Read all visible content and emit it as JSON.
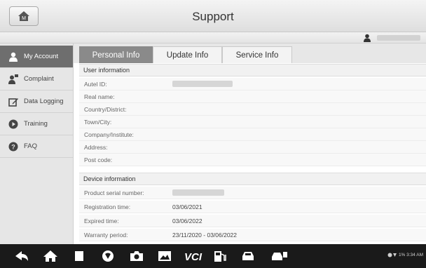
{
  "header": {
    "title": "Support",
    "home_icon": "home-icon"
  },
  "sidebar": {
    "items": [
      {
        "label": "My Account",
        "icon": "user-icon"
      },
      {
        "label": "Complaint",
        "icon": "complaint-icon"
      },
      {
        "label": "Data Logging",
        "icon": "edit-icon"
      },
      {
        "label": "Training",
        "icon": "play-icon"
      },
      {
        "label": "FAQ",
        "icon": "help-icon"
      }
    ]
  },
  "tabs": [
    "Personal Info",
    "Update Info",
    "Service Info"
  ],
  "user_info": {
    "header": "User information",
    "labels": [
      "Autel ID:",
      "Real name:",
      "Country/District:",
      "Town/City:",
      "Company/Institute:",
      "Address:",
      "Post code:"
    ]
  },
  "device_info": {
    "header": "Device information",
    "rows": [
      {
        "label": "Product serial number:",
        "value": ""
      },
      {
        "label": "Registration time:",
        "value": "03/06/2021"
      },
      {
        "label": "Expired time:",
        "value": "03/06/2022"
      },
      {
        "label": "Warranty period:",
        "value": "23/11/2020 - 03/06/2022"
      }
    ]
  },
  "status_bar": {
    "text": "1% 3:34 AM"
  },
  "colors": {
    "active_sidebar": "#6e6e6e",
    "active_tab": "#8a8a8a",
    "navbar": "#1a1a1a"
  }
}
